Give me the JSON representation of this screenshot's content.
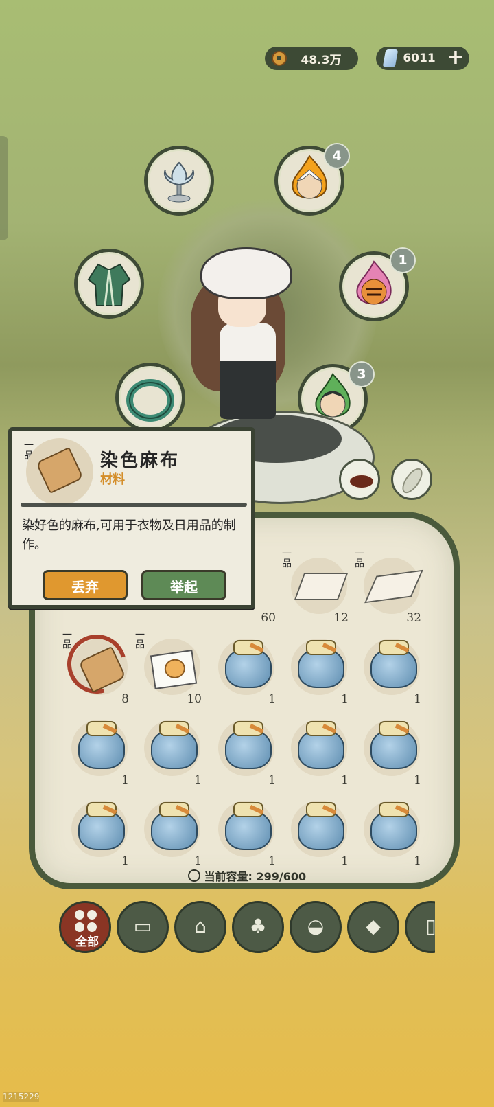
{
  "currency": {
    "coins": "48.3万",
    "gems": "6011"
  },
  "slots": {
    "top_left_icon": "lotus-goblet-icon",
    "left_icon": "green-robe-icon",
    "bracelet_icon": "jade-bracelet-icon",
    "spirit_fire": {
      "icon": "fire-spirit-icon",
      "badge": "4"
    },
    "spirit_tiger": {
      "icon": "tiger-spirit-icon",
      "badge": "1"
    },
    "spirit_green": {
      "icon": "green-spirit-icon",
      "badge": "3"
    }
  },
  "tooltip": {
    "grade": "一品",
    "title": "染色麻布",
    "type": "材料",
    "description": "染好色的麻布,可用于衣物及日用品的制作。",
    "discard_label": "丢弃",
    "lift_label": "举起"
  },
  "inventory": {
    "row1": [
      {
        "icon": "hidden-item",
        "count": "60"
      },
      {
        "icon": "folded-cloth-icon",
        "grade": "一品",
        "count": "12"
      },
      {
        "icon": "white-cloth-icon",
        "grade": "一品",
        "count": "32"
      }
    ],
    "row2": [
      {
        "icon": "dyed-linen-icon",
        "grade": "一品",
        "count": "8",
        "selected": true
      },
      {
        "icon": "egg-icon",
        "grade": "一品",
        "count": "10"
      },
      {
        "icon": "pouch-icon",
        "count": "1"
      },
      {
        "icon": "pouch-icon",
        "count": "1"
      },
      {
        "icon": "pouch-icon",
        "count": "1"
      }
    ],
    "row3": [
      "1",
      "1",
      "1",
      "1",
      "1"
    ],
    "row4": [
      "1",
      "1",
      "1",
      "1",
      "1"
    ],
    "capacity_label": "当前容量:",
    "capacity_value": "299/600"
  },
  "tabs": [
    {
      "label": "全部",
      "icon": "all-grid-icon",
      "active": true
    },
    {
      "label": "",
      "icon": "wood-log-icon"
    },
    {
      "label": "",
      "icon": "house-icon"
    },
    {
      "label": "",
      "icon": "herb-icon"
    },
    {
      "label": "",
      "icon": "rice-bowl-icon"
    },
    {
      "label": "",
      "icon": "ore-icon"
    },
    {
      "label": "",
      "icon": "scroll-icon"
    }
  ],
  "footer_id": "1215229"
}
